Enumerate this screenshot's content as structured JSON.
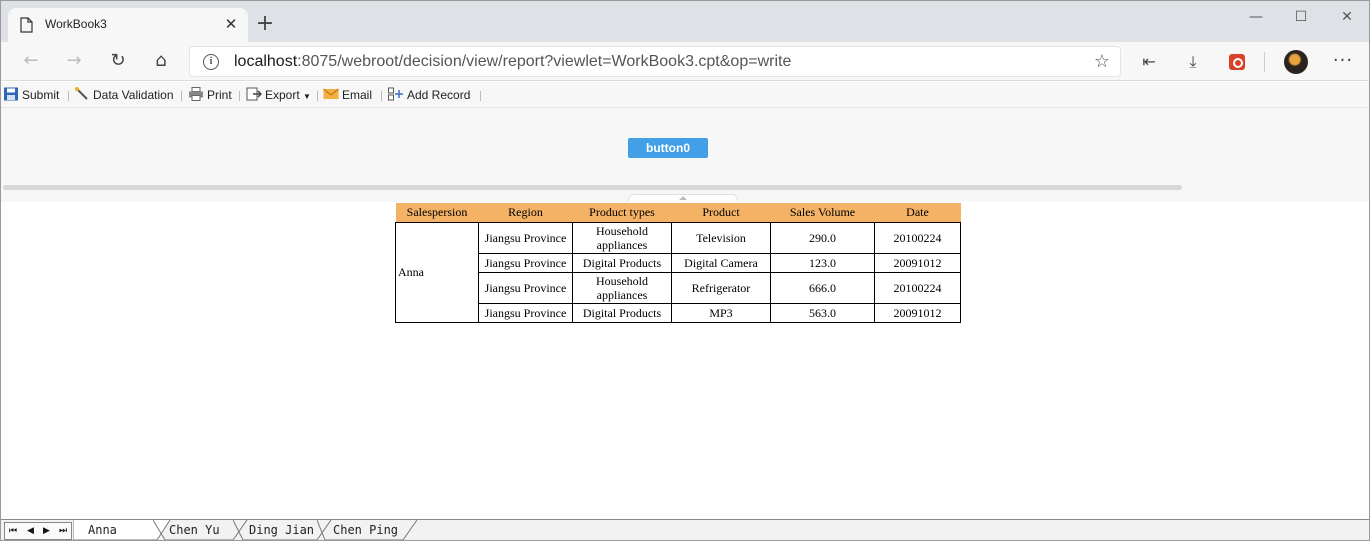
{
  "browser": {
    "tab_title": "WorkBook3",
    "new_tab": "+",
    "url_host": "localhost",
    "url_rest": ":8075/webroot/decision/view/report?viewlet=WorkBook3.cpt&op=write",
    "window_controls": {
      "minimize": "—",
      "maximize": "☐",
      "close": "✕"
    },
    "icons": [
      "back-icon",
      "forward-icon",
      "refresh-icon",
      "home-icon",
      "info-icon",
      "star-icon",
      "collections-icon",
      "download-icon",
      "extension-icon",
      "profile-avatar",
      "more-icon"
    ]
  },
  "toolbar": {
    "submit": "Submit",
    "validation": "Data Validation",
    "print": "Print",
    "export": "Export",
    "email": "Email",
    "add_record": "Add Record"
  },
  "param": {
    "button_label": "button0"
  },
  "report": {
    "headers": [
      "Salespersion",
      "Region",
      "Product types",
      "Product",
      "Sales Volume",
      "Date"
    ],
    "salesperson": "Anna",
    "rows": [
      {
        "region": "Jiangsu Province",
        "type": "Household appliances",
        "product": "Television",
        "volume": "290.0",
        "date": "20100224"
      },
      {
        "region": "Jiangsu Province",
        "type": "Digital Products",
        "product": "Digital Camera",
        "volume": "123.0",
        "date": "20091012"
      },
      {
        "region": "Jiangsu Province",
        "type": "Household appliances",
        "product": "Refrigerator",
        "volume": "666.0",
        "date": "20100224"
      },
      {
        "region": "Jiangsu Province",
        "type": "Digital Products",
        "product": "MP3",
        "volume": "563.0",
        "date": "20091012"
      }
    ]
  },
  "sheets": [
    "Anna",
    "Chen Yu",
    "Ding Jian",
    "Chen Ping"
  ],
  "active_sheet": "Anna",
  "colors": {
    "header_bg": "#f3b266",
    "button_bg": "#41a0e8"
  }
}
